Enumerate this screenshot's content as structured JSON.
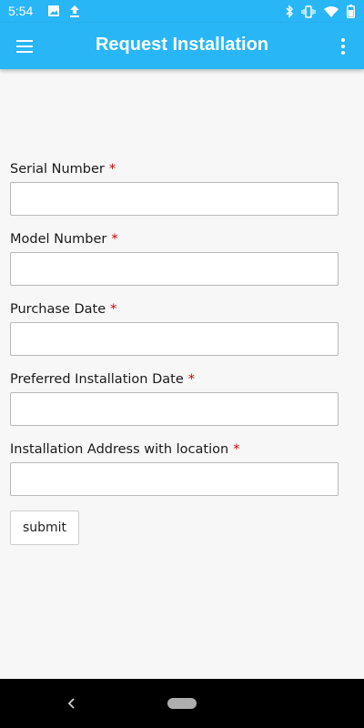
{
  "status_bar": {
    "time": "5:54",
    "left_icons": [
      "image-icon",
      "upload-icon"
    ],
    "right_icons": [
      "bluetooth-icon",
      "vibrate-icon",
      "wifi-icon",
      "battery-icon"
    ]
  },
  "app_bar": {
    "title": "Request Installation",
    "color": "#29b6f6",
    "menu_icon": "hamburger-menu-icon",
    "overflow_icon": "more-vert-icon"
  },
  "form": {
    "required_marker": "*",
    "fields": [
      {
        "label": "Serial Number",
        "value": "",
        "required": true
      },
      {
        "label": "Model Number",
        "value": "",
        "required": true
      },
      {
        "label": "Purchase Date",
        "value": "",
        "required": true
      },
      {
        "label": "Preferred Installation Date",
        "value": "",
        "required": true
      },
      {
        "label": "Installation Address with location",
        "value": "",
        "required": true
      }
    ],
    "submit_label": "submit"
  },
  "nav_bar": {
    "back_icon": "back-chevron-icon",
    "home_icon": "home-pill-icon"
  }
}
